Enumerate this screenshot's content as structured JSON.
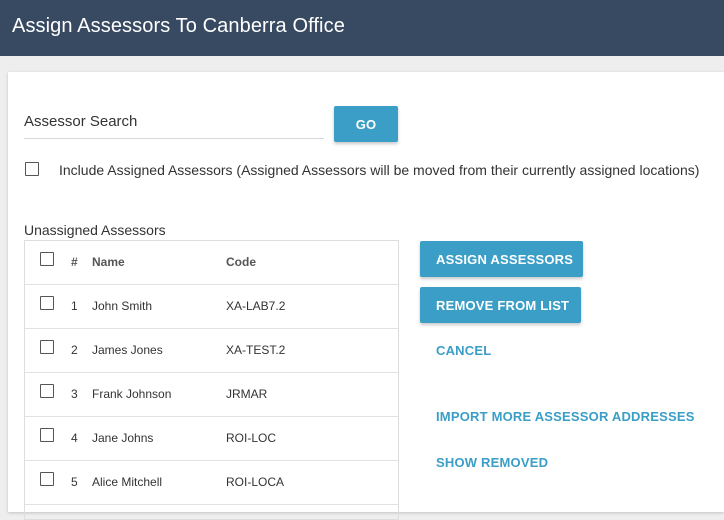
{
  "header": {
    "title": "Assign Assessors To Canberra Office"
  },
  "search": {
    "placeholder": "Assessor Search",
    "value": "",
    "go_label": "GO"
  },
  "include_assigned": {
    "label": "Include Assigned Assessors (Assigned Assessors will be moved from their currently assigned locations)",
    "checked": false
  },
  "list": {
    "title": "Unassigned Assessors",
    "columns": {
      "num": "#",
      "name": "Name",
      "code": "Code"
    },
    "rows": [
      {
        "num": "1",
        "name": "John Smith",
        "code": "XA-LAB7.2"
      },
      {
        "num": "2",
        "name": "James Jones",
        "code": "XA-TEST.2"
      },
      {
        "num": "3",
        "name": "Frank Johnson",
        "code": "JRMAR"
      },
      {
        "num": "4",
        "name": "Jane Johns",
        "code": "ROI-LOC"
      },
      {
        "num": "5",
        "name": "Alice Mitchell",
        "code": "ROI-LOCA"
      }
    ]
  },
  "actions": {
    "assign_label": "ASSIGN ASSESSORS",
    "remove_label": "REMOVE FROM LIST",
    "cancel_label": "CANCEL",
    "import_label": "IMPORT MORE ASSESSOR ADDRESSES",
    "show_removed_label": "SHOW REMOVED"
  },
  "colors": {
    "header_bg": "#384a62",
    "accent": "#3a9ec7",
    "page_bg": "#eeeeee"
  }
}
